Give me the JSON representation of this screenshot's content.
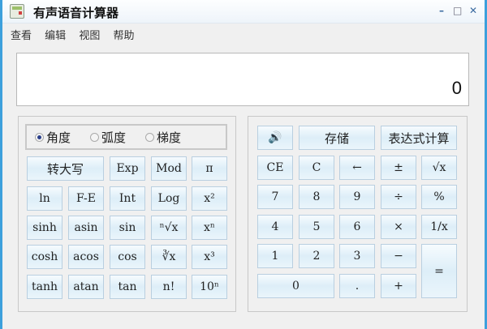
{
  "window": {
    "title": "有声语音计算器",
    "minimize": "–",
    "maximize": "□",
    "close": "✕"
  },
  "menu": [
    "查看",
    "编辑",
    "视图",
    "帮助"
  ],
  "display": {
    "value": "0"
  },
  "angle_modes": [
    {
      "label": "角度",
      "selected": true
    },
    {
      "label": "弧度",
      "selected": false
    },
    {
      "label": "梯度",
      "selected": false
    }
  ],
  "sci_buttons": [
    "转大写",
    "Exp",
    "Mod",
    "π",
    "ln",
    "F-E",
    "Int",
    "Log",
    "x²",
    "sinh",
    "asin",
    "sin",
    "ⁿ√x",
    "xⁿ",
    "cosh",
    "acos",
    "cos",
    "∛x",
    "x³",
    "tanh",
    "atan",
    "tan",
    "n!",
    "10ⁿ"
  ],
  "std_buttons": [
    "🔊",
    "存储",
    "表达式计算",
    "CE",
    "C",
    "←",
    "±",
    "√x",
    "7",
    "8",
    "9",
    "÷",
    "%",
    "4",
    "5",
    "6",
    "×",
    "1/x",
    "1",
    "2",
    "3",
    "−",
    "=",
    "0",
    ".",
    "+"
  ]
}
